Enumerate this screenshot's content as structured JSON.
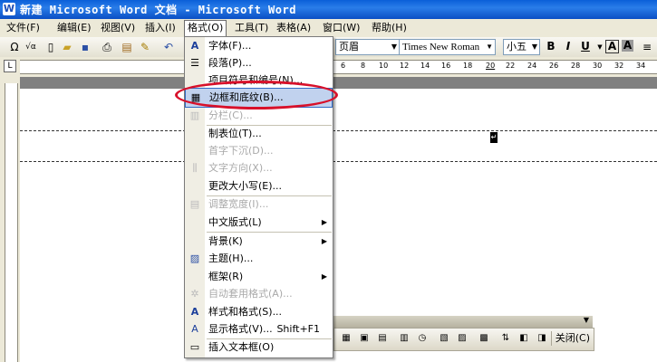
{
  "window": {
    "title": "新建 Microsoft Word 文档 - Microsoft Word",
    "icon": "word-icon"
  },
  "menubar": {
    "items": [
      {
        "label": "文件(F)"
      },
      {
        "label": "编辑(E)"
      },
      {
        "label": "视图(V)"
      },
      {
        "label": "插入(I)"
      },
      {
        "label": "格式(O)"
      },
      {
        "label": "工具(T)"
      },
      {
        "label": "表格(A)"
      },
      {
        "label": "窗口(W)"
      },
      {
        "label": "帮助(H)"
      }
    ]
  },
  "toolbar": {
    "style_value": "页眉",
    "font_value": "Times New Roman",
    "size_value": "小五",
    "bold": "B",
    "italic": "I",
    "underline": "U"
  },
  "ruler": {
    "numbers": [
      "6",
      "8",
      "10",
      "12",
      "14",
      "16",
      "18",
      "20",
      "22",
      "24",
      "26",
      "28",
      "30",
      "32",
      "34"
    ]
  },
  "document": {
    "paragraph_mark": "↵"
  },
  "format_menu": {
    "items": [
      {
        "label": "字体(F)...",
        "icon": "font-icon",
        "enabled": true
      },
      {
        "label": "段落(P)...",
        "icon": "paragraph-icon",
        "enabled": true
      },
      {
        "label": "项目符号和编号(N)...",
        "icon": "",
        "enabled": true
      },
      {
        "label": "边框和底纹(B)...",
        "icon": "border-icon",
        "enabled": true,
        "selected": true
      },
      {
        "label": "分栏(C)...",
        "icon": "columns-icon",
        "enabled": false
      },
      {
        "label": "制表位(T)...",
        "icon": "",
        "enabled": true
      },
      {
        "label": "首字下沉(D)...",
        "icon": "",
        "enabled": false
      },
      {
        "label": "文字方向(X)...",
        "icon": "text-direction-icon",
        "enabled": false
      },
      {
        "label": "更改大小写(E)...",
        "icon": "",
        "enabled": true
      },
      {
        "label": "调整宽度(I)...",
        "icon": "fit-width-icon",
        "enabled": false
      },
      {
        "label": "中文版式(L)",
        "icon": "",
        "enabled": true,
        "submenu": true
      },
      {
        "label": "背景(K)",
        "icon": "",
        "enabled": true,
        "submenu": true
      },
      {
        "label": "主题(H)...",
        "icon": "theme-icon",
        "enabled": true
      },
      {
        "label": "框架(R)",
        "icon": "",
        "enabled": true,
        "submenu": true
      },
      {
        "label": "自动套用格式(A)...",
        "icon": "autoformat-icon",
        "enabled": false
      },
      {
        "label": "样式和格式(S)...",
        "icon": "styles-icon",
        "enabled": true
      },
      {
        "label": "显示格式(V)...",
        "icon": "reveal-format-icon",
        "enabled": true,
        "shortcut": "Shift+F1"
      },
      {
        "label": "插入文本框(O)",
        "icon": "textbox-icon",
        "enabled": true
      }
    ]
  },
  "float_toolbar": {
    "close_label": "关闭(C)"
  },
  "colors": {
    "titlebar": "#0a5fd8",
    "highlight": "#d8102a",
    "menu_selection": "#c1d2ee"
  }
}
